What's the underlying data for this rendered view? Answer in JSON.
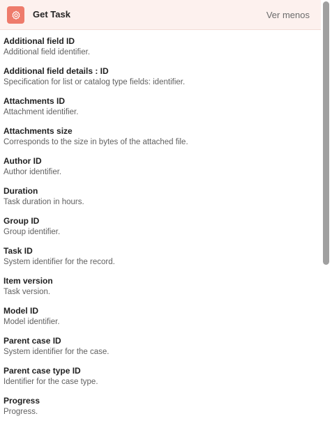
{
  "header": {
    "title": "Get Task",
    "toggle_label": "Ver menos",
    "icon": "task-settings-icon",
    "accent_color": "#ee7b6b",
    "background_color": "#fdf1ee"
  },
  "fields": [
    {
      "name": "Additional field ID",
      "description": "Additional field identifier."
    },
    {
      "name": "Additional field details : ID",
      "description": "Specification for list or catalog type fields: identifier."
    },
    {
      "name": "Attachments ID",
      "description": "Attachment identifier."
    },
    {
      "name": "Attachments size",
      "description": "Corresponds to the size in bytes of the attached file."
    },
    {
      "name": "Author ID",
      "description": "Author identifier."
    },
    {
      "name": "Duration",
      "description": "Task duration in hours."
    },
    {
      "name": "Group ID",
      "description": "Group identifier."
    },
    {
      "name": "Task ID",
      "description": "System identifier for the record."
    },
    {
      "name": "Item version",
      "description": "Task version."
    },
    {
      "name": "Model ID",
      "description": "Model identifier."
    },
    {
      "name": "Parent case ID",
      "description": "System identifier for the case."
    },
    {
      "name": "Parent case type ID",
      "description": "Identifier for the case type."
    },
    {
      "name": "Progress",
      "description": "Progress."
    }
  ]
}
